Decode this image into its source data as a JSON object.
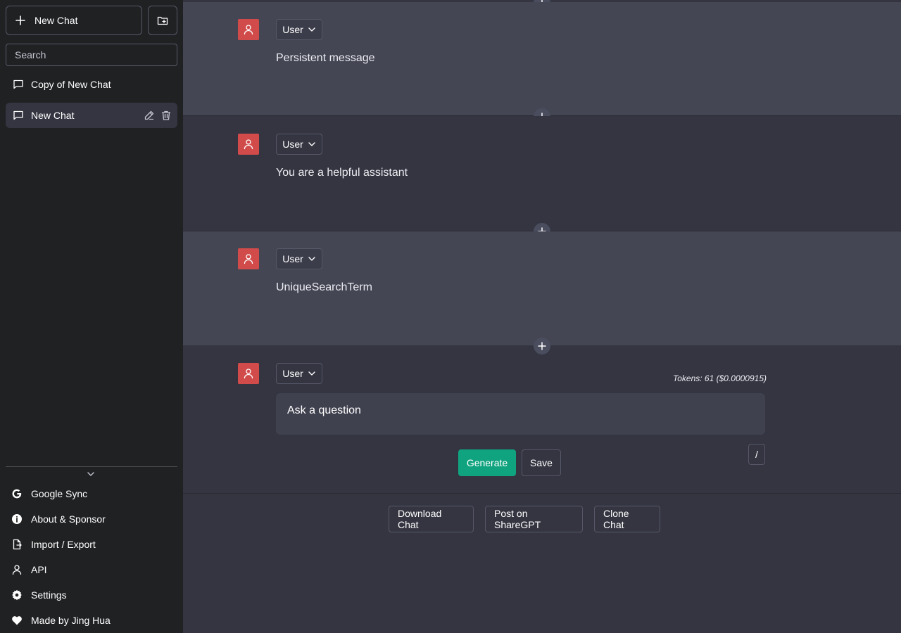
{
  "sidebar": {
    "new_chat_label": "New Chat",
    "search_placeholder": "Search",
    "chats": [
      {
        "label": "Copy of New Chat"
      },
      {
        "label": "New Chat"
      }
    ],
    "menu": [
      {
        "label": "Google Sync",
        "icon": "google-icon"
      },
      {
        "label": "About & Sponsor",
        "icon": "info-icon"
      },
      {
        "label": "Import / Export",
        "icon": "file-export-icon"
      },
      {
        "label": "API",
        "icon": "person-icon"
      },
      {
        "label": "Settings",
        "icon": "gear-icon"
      },
      {
        "label": "Made by Jing Hua",
        "icon": "heart-icon"
      }
    ]
  },
  "messages": [
    {
      "role": "User",
      "content": "Persistent message"
    },
    {
      "role": "User",
      "content": "You are a helpful assistant"
    },
    {
      "role": "User",
      "content": "UniqueSearchTerm"
    }
  ],
  "composer": {
    "role": "User",
    "placeholder": "Ask a question",
    "tokens": "Tokens: 61 ($0.0000915)",
    "generate_label": "Generate",
    "save_label": "Save",
    "slash_label": "/"
  },
  "footer": {
    "download_label": "Download Chat",
    "share_label": "Post on ShareGPT",
    "clone_label": "Clone Chat"
  },
  "colors": {
    "accent": "#10a37f",
    "avatar": "#d14b4b",
    "sidebar_bg": "#202123",
    "main_bg": "#343541",
    "message_light_bg": "#444654"
  }
}
